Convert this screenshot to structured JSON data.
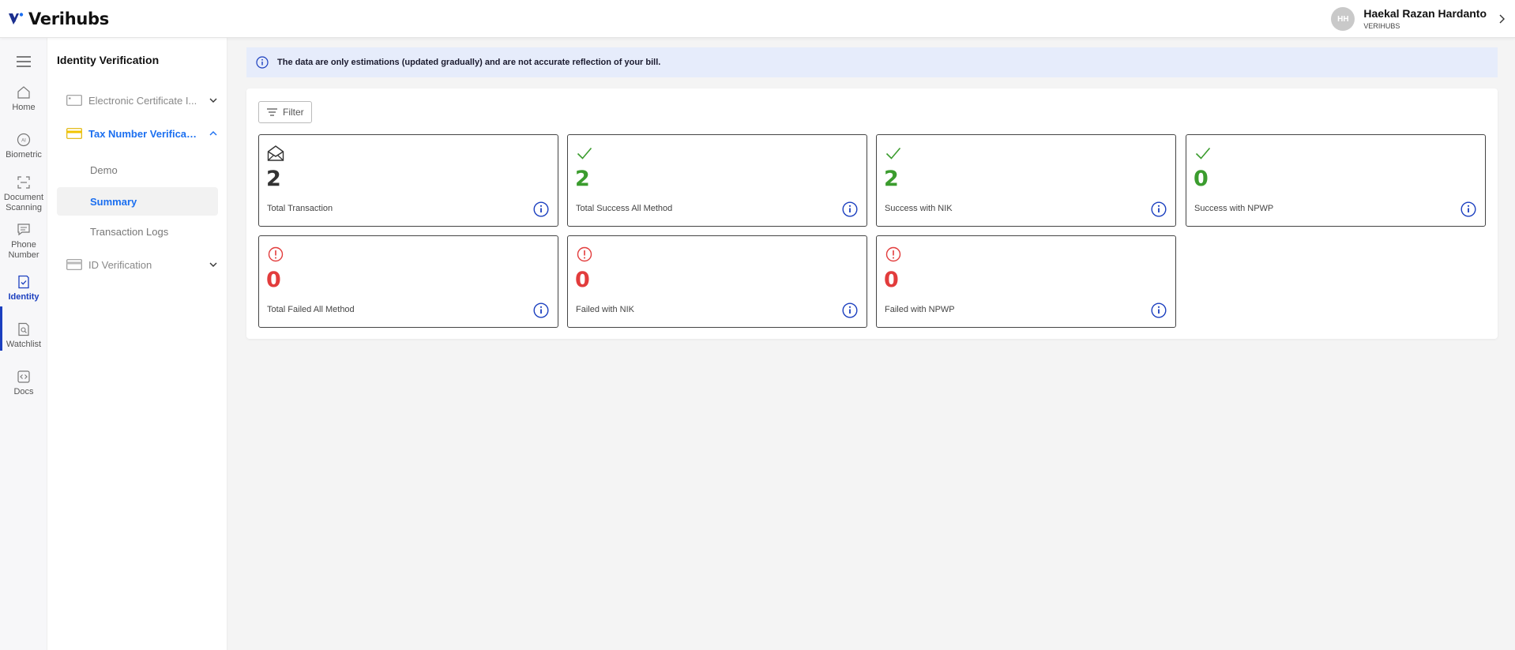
{
  "app": {
    "brand": "Verihubs"
  },
  "user": {
    "initials": "HH",
    "name": "Haekal Razan Hardanto",
    "org": "VERIHUBS"
  },
  "rail": {
    "items": [
      {
        "label": "Home",
        "icon": "home-icon"
      },
      {
        "label": "Biometric",
        "icon": "ai-face-icon"
      },
      {
        "label": "Document Scanning",
        "icon": "scan-icon"
      },
      {
        "label": "Phone Number",
        "icon": "message-icon"
      },
      {
        "label": "Identity",
        "icon": "identity-check-icon",
        "active": true
      },
      {
        "label": "Watchlist",
        "icon": "document-search-icon"
      },
      {
        "label": "Docs",
        "icon": "code-icon"
      }
    ]
  },
  "subnav": {
    "title": "Identity Verification",
    "groups": [
      {
        "label": "Electronic Certificate I...",
        "state": "collapsed",
        "icon": "card-icon"
      },
      {
        "label": "Tax Number Verificat...",
        "state": "expanded",
        "icon": "card-icon-yellow",
        "children": [
          {
            "label": "Demo"
          },
          {
            "label": "Summary",
            "active": true
          },
          {
            "label": "Transaction Logs"
          }
        ]
      },
      {
        "label": "ID Verification",
        "state": "collapsed",
        "icon": "card-icon"
      }
    ]
  },
  "banner": {
    "text": "The data are only estimations (updated gradually) and are not accurate reflection of your bill."
  },
  "filter": {
    "label": "Filter"
  },
  "stats": [
    {
      "value": "2",
      "label": "Total Transaction",
      "kind": "neutral",
      "icon": "envelope-open-icon"
    },
    {
      "value": "2",
      "label": "Total Success All Method",
      "kind": "success",
      "icon": "check-icon"
    },
    {
      "value": "2",
      "label": "Success with NIK",
      "kind": "success",
      "icon": "check-icon"
    },
    {
      "value": "0",
      "label": "Success with NPWP",
      "kind": "success",
      "icon": "check-icon"
    },
    {
      "value": "0",
      "label": "Total Failed All Method",
      "kind": "danger",
      "icon": "alert-circle-icon"
    },
    {
      "value": "0",
      "label": "Failed with NIK",
      "kind": "danger",
      "icon": "alert-circle-icon"
    },
    {
      "value": "0",
      "label": "Failed with NPWP",
      "kind": "danger",
      "icon": "alert-circle-icon"
    }
  ],
  "colors": {
    "accent": "#1b3fbf",
    "link": "#1b6ff0",
    "success": "#3b9c2e",
    "danger": "#e23c3c",
    "banner": "#e6ecfb"
  }
}
